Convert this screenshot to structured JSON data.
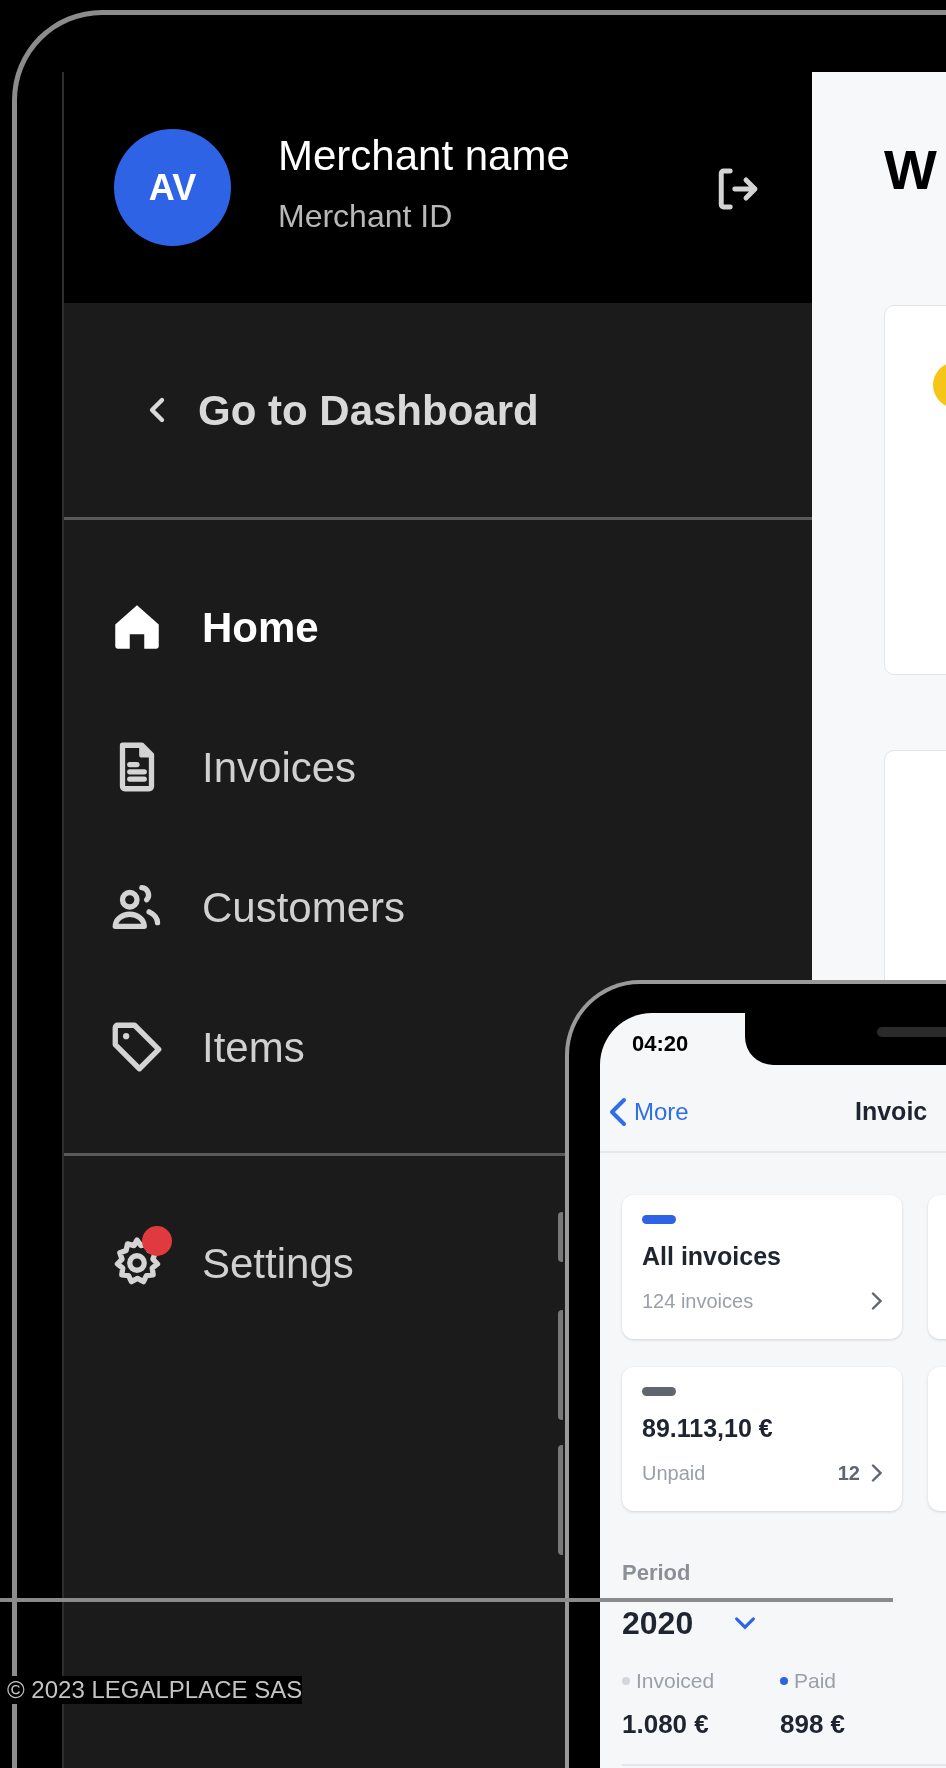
{
  "tablet": {
    "header": {
      "avatar_initials": "AV",
      "merchant_name": "Merchant name",
      "merchant_id": "Merchant ID"
    },
    "back_link": "Go to Dashboard",
    "nav": [
      {
        "label": "Home",
        "kind": "home",
        "selected": true
      },
      {
        "label": "Invoices",
        "kind": "invoices",
        "selected": false
      },
      {
        "label": "Customers",
        "kind": "customers",
        "selected": false
      },
      {
        "label": "Items",
        "kind": "items",
        "selected": false
      }
    ],
    "settings": {
      "label": "Settings",
      "notification": true
    },
    "content": {
      "heading": "W"
    }
  },
  "phone": {
    "status_time": "04:20",
    "nav": {
      "back": "More",
      "title": "Invoic"
    },
    "cards": [
      {
        "kind": "total",
        "title": "All invoices",
        "subtitle": "124 invoices",
        "color": "#2f63e6"
      },
      {
        "kind": "amount",
        "title": "89.113,10 €",
        "subtitle": "Unpaid",
        "count": "12",
        "color": "#5f6670"
      }
    ],
    "period": {
      "label": "Period",
      "value": "2020"
    },
    "legend": [
      {
        "label": "Invoiced",
        "value": "1.080 €",
        "color": "#d3d6db"
      },
      {
        "label": "Paid",
        "value": "898 €",
        "color": "#2f63e6"
      }
    ]
  },
  "footer": {
    "copyright": "© 2023 LEGALPLACE SAS"
  }
}
